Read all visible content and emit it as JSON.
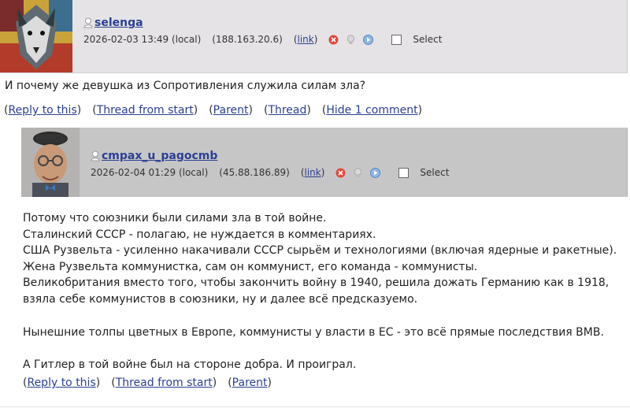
{
  "comment1": {
    "username": "selenga",
    "timestamp": "2026-02-03 13:49 (local)",
    "ip": "(188.163.20.6)",
    "link_label": "link",
    "select_label": "Select",
    "text": "И почему же девушка из Сопротивления служила силам зла?",
    "actions": [
      "Reply to this",
      "Thread from start",
      "Parent",
      "Thread",
      "Hide 1 comment"
    ]
  },
  "comment2": {
    "username": "cmpax_u_pagocmb",
    "timestamp": "2026-02-04 01:29 (local)",
    "ip": "(45.88.186.89)",
    "link_label": "link",
    "select_label": "Select",
    "paragraphs": [
      "Потому что союзники были силами зла в той войне.",
      "Сталинский СССР - полагаю, не нуждается в комментариях.",
      "США Рузвельта - усиленно накачивали СССР сырьём и технологиями (включая ядерные и ракетные). Жена Рузвельта коммунистка, сам он коммунист, его команда - коммунисты.",
      "Великобритания вместо того, чтобы закончить войну в 1940, решила дожать Германию как в 1918, взяла себе коммунистов в союзники, ну и далее всё предсказуемо.",
      "",
      "Нынешние толпы цветных в Европе, коммунисты у власти в ЕС - это всё прямые последствия ВМВ.",
      "",
      "А Гитлер в той войне был на стороне добра. И проиграл."
    ],
    "actions": [
      "Reply to this",
      "Thread from start",
      "Parent"
    ]
  },
  "icons": [
    "user-icon",
    "delete-icon",
    "track-icon",
    "expand-icon",
    "checkbox"
  ],
  "colors": {
    "header1_bg": "#e5e3e6",
    "header2_bg": "#c7c6c7",
    "link": "#2a3f94"
  }
}
